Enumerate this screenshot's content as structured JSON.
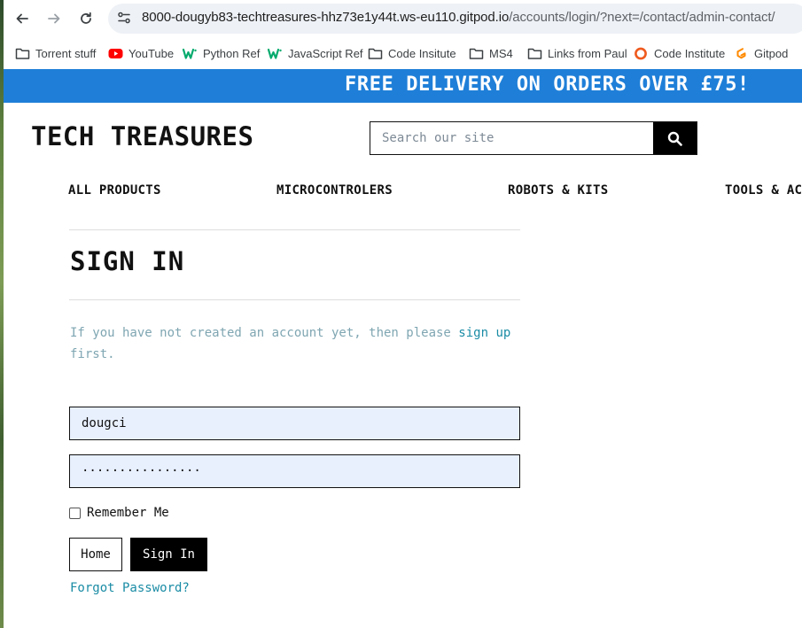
{
  "browser": {
    "url_host": "8000-dougyb83-techtreasures-hhz73e1y44t.ws-eu110.gitpod.io",
    "url_path": "/accounts/login/?next=/contact/admin-contact/",
    "bookmarks": [
      {
        "label": "Torrent stuff",
        "icon": "folder-icon"
      },
      {
        "label": "YouTube",
        "icon": "youtube-icon"
      },
      {
        "label": "Python Ref",
        "icon": "w3schools-icon"
      },
      {
        "label": "JavaScript Ref",
        "icon": "w3schools-icon"
      },
      {
        "label": "Code Insitute",
        "icon": "folder-icon"
      },
      {
        "label": "MS4",
        "icon": "folder-icon"
      },
      {
        "label": "Links from Paul",
        "icon": "folder-icon"
      },
      {
        "label": "Code Institute",
        "icon": "code-institute-icon"
      },
      {
        "label": "Gitpod",
        "icon": "gitpod-icon"
      }
    ]
  },
  "promo": {
    "text": "FREE DELIVERY ON ORDERS OVER £75!",
    "color": "#1f7fd8"
  },
  "header": {
    "logo": "TECH TREASURES",
    "search_placeholder": "Search our site"
  },
  "nav": {
    "items": [
      "ALL PRODUCTS",
      "MICROCONTROLERS",
      "ROBOTS & KITS",
      "TOOLS & AC"
    ]
  },
  "signin": {
    "title": "SIGN IN",
    "info_before": "If you have not created an account yet, then please ",
    "info_link": "sign up",
    "info_after": " first.",
    "username_value": "dougci",
    "password_value": "················",
    "remember_label": "Remember Me",
    "home_button": "Home",
    "signin_button": "Sign In",
    "forgot_link": "Forgot Password?"
  }
}
